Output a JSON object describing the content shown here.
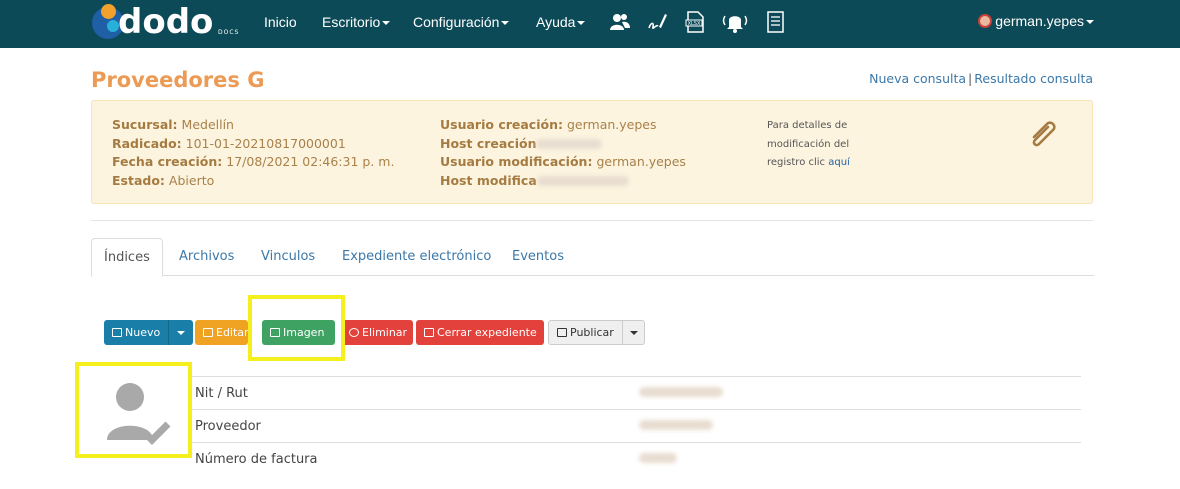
{
  "nav": {
    "logo": "dodo",
    "logo_sub": "DOCS",
    "items": [
      "Inicio",
      "Escritorio",
      "Configuración",
      "Ayuda"
    ],
    "icons": [
      "users-icon",
      "signature-icon",
      "xlsx-icon",
      "bell-icon",
      "document-list-icon"
    ],
    "user": "german.yepes"
  },
  "header": {
    "title": "Proveedores G",
    "link_new": "Nueva consulta",
    "link_sep": "|",
    "link_result": "Resultado consulta"
  },
  "info": {
    "sucursal_label": "Sucursal:",
    "sucursal": "Medellín",
    "radicado_label": "Radicado:",
    "radicado": "101-01-20210817000001",
    "fecha_label": "Fecha creación:",
    "fecha": "17/08/2021 02:46:31 p. m.",
    "estado_label": "Estado:",
    "estado": "Abierto",
    "usuario_creacion_label": "Usuario creación:",
    "usuario_creacion": "german.yepes",
    "host_creacion_label": "Host creación",
    "usuario_mod_label": "Usuario modificación:",
    "usuario_mod": "german.yepes",
    "host_mod_label": "Host modifica",
    "note": "Para detalles de modificación del registro clic",
    "note_link": "aquí"
  },
  "tabs": [
    "Índices",
    "Archivos",
    "Vinculos",
    "Expediente electrónico",
    "Eventos"
  ],
  "toolbar": {
    "nuevo": "Nuevo",
    "editar": "Editar",
    "imagen": "Imagen",
    "eliminar": "Eliminar",
    "cerrar": "Cerrar expediente",
    "publicar": "Publicar"
  },
  "fields": [
    {
      "label": "Nit / Rut"
    },
    {
      "label": "Proveedor"
    },
    {
      "label": "Número de factura"
    }
  ],
  "colors": {
    "navbar": "#0d4a57",
    "title": "#ec9a54",
    "highlight": "#f5ef1e"
  }
}
